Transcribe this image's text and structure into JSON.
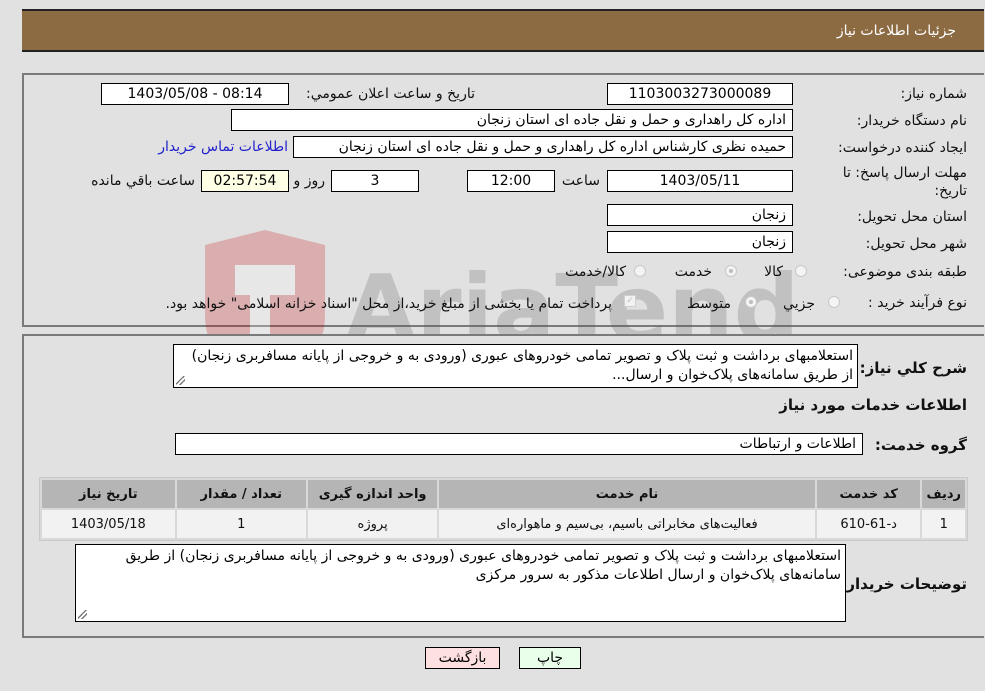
{
  "header": {
    "title": "جزئیات اطلاعات نیاز"
  },
  "form": {
    "need_number": {
      "label": "شماره نیاز:",
      "value": "1103003273000089"
    },
    "announce_datetime": {
      "label": "تاریخ و ساعت اعلان عمومي:",
      "value": "1403/05/08 - 08:14"
    },
    "buyer_org": {
      "label": "نام دستگاه خريدار:",
      "value": "اداره کل راهداری و حمل و نقل جاده ای استان زنجان"
    },
    "requester": {
      "label": "ايجاد کننده درخواست:",
      "value": "حمیده نظری کارشناس اداره کل راهداری و حمل و نقل جاده ای استان زنجان"
    },
    "buyer_contact_link": "اطلاعات تماس خريدار",
    "deadline": {
      "label_line1": "مهلت ارسال پاسخ: تا",
      "label_line2": "تاريخ:",
      "date": "1403/05/11",
      "time_label": "ساعت",
      "time": "12:00",
      "days": "3",
      "days_label": "روز و",
      "remaining": "02:57:54",
      "remaining_label": "ساعت باقي مانده"
    },
    "delivery_province": {
      "label": "استان محل تحويل:",
      "value": "زنجان"
    },
    "delivery_city": {
      "label": "شهر محل تحويل:",
      "value": "زنجان"
    },
    "category": {
      "label": "طبقه بندی موضوعی:",
      "options": [
        "کالا",
        "خدمت",
        "کالا/خدمت"
      ],
      "selected": "خدمت"
    },
    "purchase_type": {
      "label": "نوع فرآيند خريد :",
      "options": [
        "جزيي",
        "متوسط"
      ],
      "selected": "متوسط",
      "treasury_checkbox_label": "پرداخت تمام يا بخشی از مبلغ خريد،از محل \"اسناد خزانه اسلامی\" خواهد بود.",
      "treasury_checked": true
    }
  },
  "details": {
    "general_desc_label": "شرح کلي نياز:",
    "general_desc": "استعلامبهای برداشت و ثبت پلاک و تصویر تمامی خودروهای عبوری (ورودی به و خروجی از پایانه مسافربری زنجان) از طریق سامانه‌های پلاک‌خوان و ارسال...",
    "services_section_title": "اطلاعات خدمات مورد نياز",
    "service_group_label": "گروه خدمت:",
    "service_group_value": "اطلاعات و ارتباطات",
    "table": {
      "headers": [
        "رديف",
        "کد خدمت",
        "نام خدمت",
        "واحد اندازه گيری",
        "تعداد / مقدار",
        "تاريخ نياز"
      ],
      "rows": [
        [
          "1",
          "د-61-610",
          "فعالیت‌های مخابراتی باسیم، بی‌سیم و ماهواره‌ای",
          "پروژه",
          "1",
          "1403/05/18"
        ]
      ]
    },
    "buyer_notes_label": "توضيحات خريدار:",
    "buyer_notes": "استعلامبهای برداشت و ثبت پلاک و تصویر تمامی خودروهای عبوری (ورودی به و خروجی از پایانه مسافربری زنجان) از طریق سامانه‌های پلاک‌خوان و ارسال اطلاعات مذکور به سرور مرکزی"
  },
  "buttons": {
    "print": "چاپ",
    "back": "بازگشت"
  },
  "watermark": {
    "text": "AriaTender.neT"
  }
}
